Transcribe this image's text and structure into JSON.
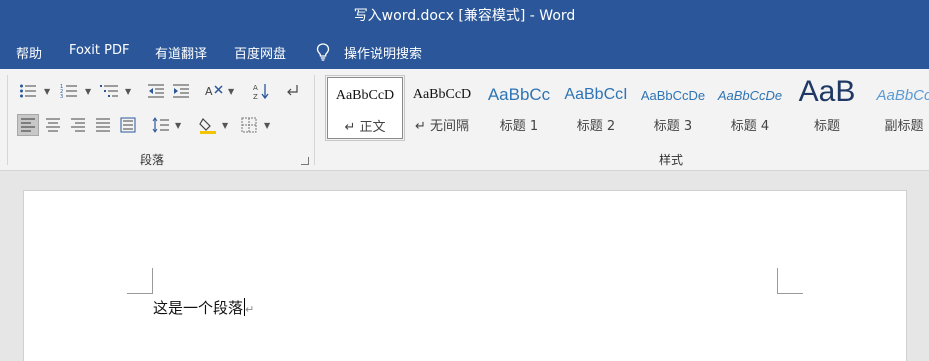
{
  "window": {
    "title": "写入word.docx [兼容模式]  -  Word"
  },
  "menu": {
    "items": [
      "帮助",
      "Foxit PDF",
      "有道翻译",
      "百度网盘"
    ],
    "tell_me": "操作说明搜索"
  },
  "ribbon": {
    "paragraph_group_label": "段落",
    "styles_group_label": "样式",
    "styles": [
      {
        "sample": "AaBbCcD",
        "name": "↵ 正文"
      },
      {
        "sample": "AaBbCcD",
        "name": "↵ 无间隔"
      },
      {
        "sample": "AaBbCc",
        "name": "标题 1"
      },
      {
        "sample": "AaBbCcI",
        "name": "标题 2"
      },
      {
        "sample": "AaBbCcDe",
        "name": "标题 3"
      },
      {
        "sample": "AaBbCcDe",
        "name": "标题 4"
      },
      {
        "sample": "AaB",
        "name": "标题"
      },
      {
        "sample": "AaBbCc",
        "name": "副标题"
      }
    ],
    "selected_style": "正文",
    "accent_color": "#2b579a",
    "heading_color": "#2e74b5",
    "title_color": "#1f3864"
  },
  "document": {
    "paragraph": "这是一个段落",
    "paragraph_mark": "↵"
  }
}
